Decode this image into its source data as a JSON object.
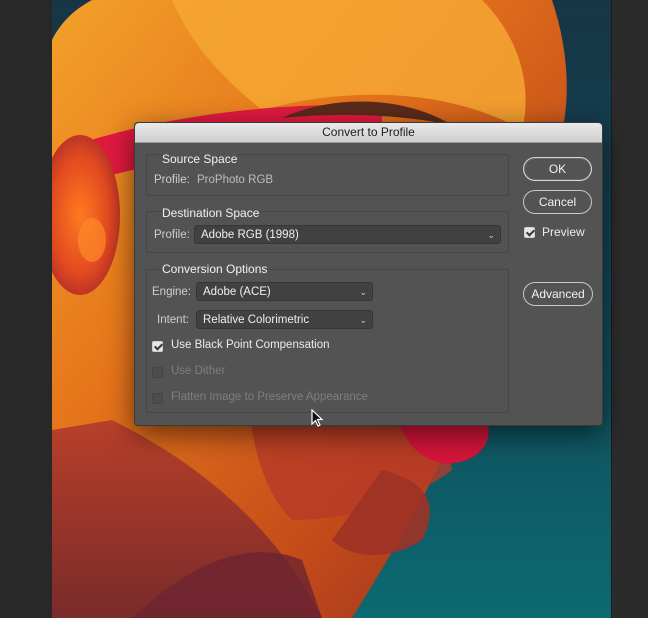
{
  "dialog": {
    "title": "Convert to Profile",
    "source_space": {
      "heading": "Source Space",
      "profile_label": "Profile:",
      "profile_value": "ProPhoto RGB"
    },
    "destination_space": {
      "heading": "Destination Space",
      "profile_label": "Profile:",
      "profile_value": "Adobe RGB (1998)"
    },
    "conversion_options": {
      "heading": "Conversion Options",
      "engine_label": "Engine:",
      "engine_value": "Adobe (ACE)",
      "intent_label": "Intent:",
      "intent_value": "Relative Colorimetric",
      "black_point": {
        "label": "Use Black Point Compensation",
        "checked": true,
        "enabled": true
      },
      "dither": {
        "label": "Use Dither",
        "checked": false,
        "enabled": false
      },
      "flatten": {
        "label": "Flatten Image to Preserve Appearance",
        "checked": false,
        "enabled": false
      }
    },
    "buttons": {
      "ok": "OK",
      "cancel": "Cancel",
      "advanced": "Advanced"
    },
    "preview": {
      "label": "Preview",
      "checked": true
    }
  },
  "colors": {
    "dialog_bg": "#535353",
    "title_bar": "#dcdcdc",
    "photo_teal": "#0c6a70",
    "skin_orange": "#e8741c",
    "lips_red": "#d4153a"
  },
  "icons": {
    "select_chevron": "chevron-updown-icon",
    "cursor": "mouse-pointer-icon"
  }
}
